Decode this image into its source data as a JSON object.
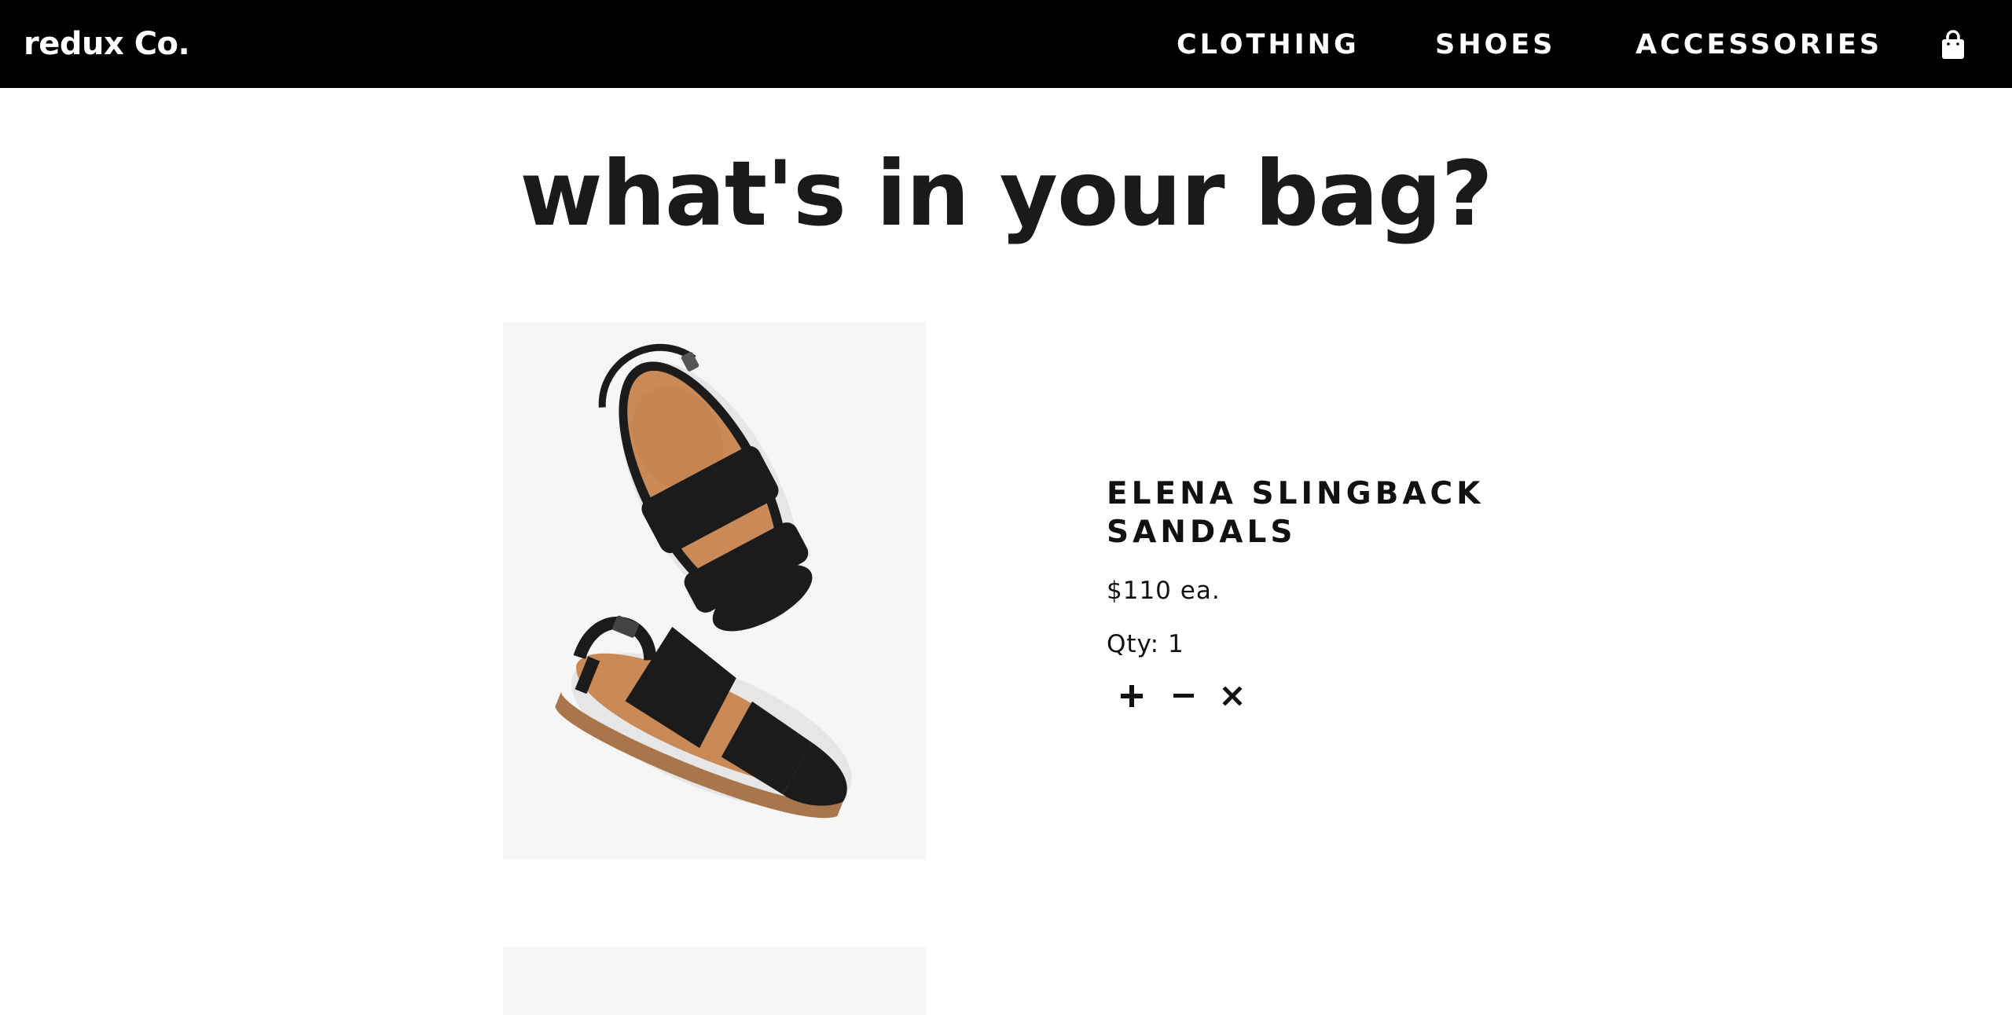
{
  "brand": {
    "name": "redux Co."
  },
  "nav": {
    "links": [
      {
        "label": "CLOTHING"
      },
      {
        "label": "SHOES"
      },
      {
        "label": "ACCESSORIES"
      }
    ],
    "bag_icon": "shopping-bag-icon"
  },
  "page": {
    "title": "what's in your bag?"
  },
  "cart": {
    "items": [
      {
        "name": "ELENA SLINGBACK SANDALS",
        "price": "$110 ea.",
        "qty_text": "Qty: 1",
        "image_icon": "black-slingback-sandals-photo",
        "actions": [
          {
            "icon": "plus-icon"
          },
          {
            "icon": "minus-icon"
          },
          {
            "icon": "close-icon"
          }
        ]
      }
    ]
  },
  "colors": {
    "navbar_bg": "#000000",
    "nav_text": "#ffffff",
    "title_text": "#1a1a1a",
    "image_bg": "#f6f6f6",
    "leather": "#1b1b1b",
    "footbed": "#c98a58"
  }
}
